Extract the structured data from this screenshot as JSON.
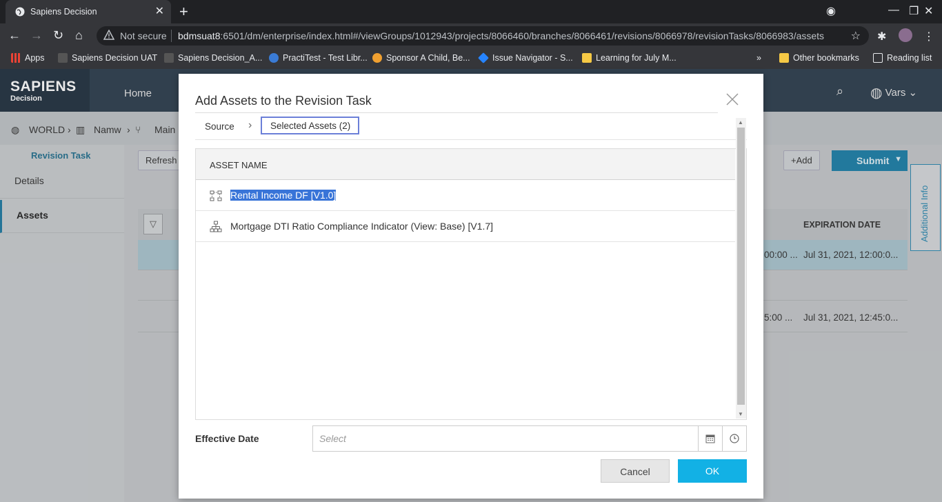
{
  "browser": {
    "tab_title": "Sapiens Decision",
    "not_secure": "Not secure",
    "url_host": "bdmsuat8",
    "url_rest": ":6501/dm/enterprise/index.html#/viewGroups/1012943/projects/8066460/branches/8066461/revisions/8066978/revisionTasks/8066983/assets",
    "bookmarks": [
      "Apps",
      "Sapiens Decision UAT",
      "Sapiens Decision_A...",
      "PractiTest - Test Libr...",
      "Sponsor A Child, Be...",
      "Issue Navigator - S...",
      "Learning for July M..."
    ],
    "other_bookmarks": "Other bookmarks",
    "reading_list": "Reading list",
    "overflow": "»"
  },
  "app": {
    "logo_main": "SAPIENS",
    "logo_sub": "Decision",
    "nav_home": "Home",
    "user_name": "Vars",
    "breadcrumb": [
      "WORLD",
      "Namw",
      "Main"
    ],
    "left_title": "Revision Task",
    "left_items": [
      "Details",
      "Assets"
    ],
    "refresh_label": "Refresh",
    "add_label": "+Add",
    "submit_label": "Submit",
    "additional_info": "Additional Info",
    "expiration_header": "EXPIRATION DATE",
    "rows": [
      {
        "partial": "00:00 ...",
        "expiration": "Jul 31, 2021, 12:00:0..."
      },
      {
        "partial": "5:00 ...",
        "expiration": "Jul 31, 2021, 12:45:0..."
      }
    ]
  },
  "modal": {
    "title": "Add Assets to the Revision Task",
    "crumb_source": "Source",
    "crumb_selected": "Selected Assets (2)",
    "column_header": "ASSET NAME",
    "assets": [
      {
        "name": "Rental Income DF [V1.0]",
        "icon": "decision-flow-icon",
        "highlighted": true
      },
      {
        "name": "Mortgage DTI Ratio Compliance Indicator (View: Base) [V1.7]",
        "icon": "hierarchy-icon",
        "highlighted": false
      }
    ],
    "effective_date_label": "Effective Date",
    "effective_date_placeholder": "Select",
    "cancel_label": "Cancel",
    "ok_label": "OK"
  },
  "colors": {
    "accent": "#12b1e5",
    "selection": "#3874d8",
    "header": "#2d3e4e"
  }
}
